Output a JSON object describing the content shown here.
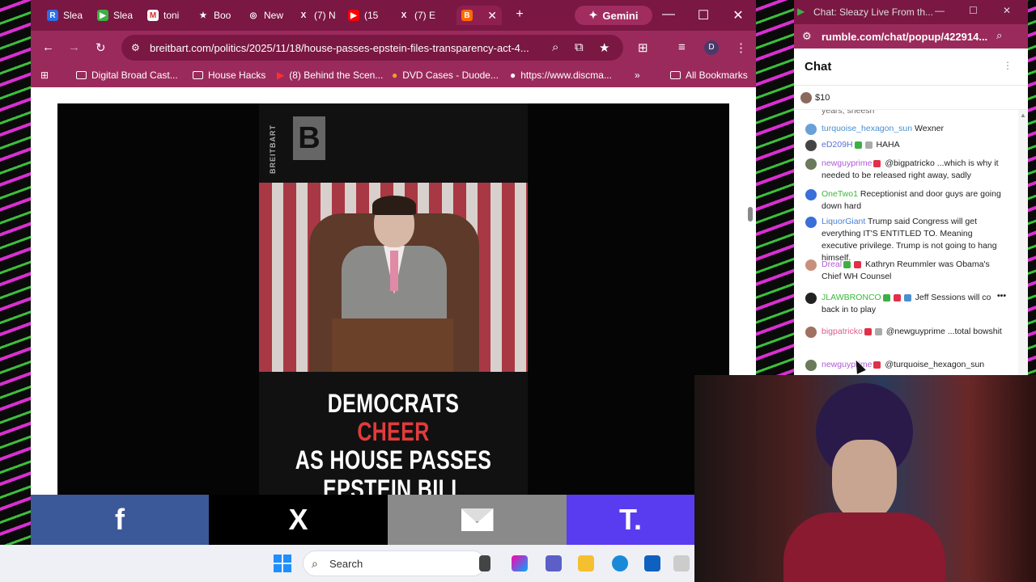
{
  "browser": {
    "tabs": [
      {
        "label": "Slea",
        "icon": "R",
        "color": "#2a6ee8"
      },
      {
        "label": "Slea",
        "icon": "▶",
        "color": "#3cb043"
      },
      {
        "label": "toni",
        "icon": "M",
        "color": "#d93025"
      },
      {
        "label": "Boo",
        "icon": "★",
        "color": "#555555"
      },
      {
        "label": "New",
        "icon": "◎",
        "color": "#555555"
      },
      {
        "label": "(7) N",
        "icon": "X",
        "color": "#000000"
      },
      {
        "label": "(15",
        "icon": "▶",
        "color": "#ff0000"
      },
      {
        "label": "(7) E",
        "icon": "X",
        "color": "#000000"
      }
    ],
    "active_tab_icon": "B",
    "gemini_label": "Gemini",
    "url": "breitbart.com/politics/2025/11/18/house-passes-epstein-files-transparency-act-4...",
    "profile_initial": "D",
    "bookmarks": [
      "Digital Broad Cast...",
      "House Hacks",
      "(8) Behind the Scen...",
      "DVD Cases - Duode...",
      "https://www.discma..."
    ],
    "all_bookmarks": "All Bookmarks"
  },
  "video": {
    "logo_letter": "B",
    "logo_word": "BREITBART",
    "headline_line1_a": "DEMOCRATS",
    "headline_line1_b": "CHEER",
    "headline_line2": "AS HOUSE PASSES",
    "headline_line3": "EPSTEIN BILL"
  },
  "share": {
    "facebook": "f",
    "x": "X",
    "truth": "T."
  },
  "taskbar": {
    "search_placeholder": "Search"
  },
  "chat": {
    "window_title": "Chat: Sleazy Live From th...",
    "url": "rumble.com/chat/popup/422914...",
    "heading": "Chat",
    "rant_amount": "$10",
    "cutoff_text": "years, sheesh",
    "messages": [
      {
        "user": "turquoise_hexagon_sun",
        "user_color": "#4a8fd0",
        "avatar": "#6aa0d8",
        "text": "Wexner"
      },
      {
        "user": "eD209H",
        "user_color": "#5a6fd6",
        "avatar": "#444444",
        "text": "HAHA"
      },
      {
        "user": "newguyprime",
        "user_color": "#b05ad8",
        "avatar": "#6b7a5a",
        "text": "@bigpatricko ...which is why it needed to be released right away, sadly"
      },
      {
        "user": "OneTwo1",
        "user_color": "#3ab83a",
        "avatar": "#3a6fd8",
        "text": "Receptionist and door guys are going down hard"
      },
      {
        "user": "LiquorGiant",
        "user_color": "#4a7fd8",
        "avatar": "#3a6fd8",
        "text": "Trump said Congress will get everything IT'S ENTITLED TO. Meaning executive privilege. Trump is not going to hang himself."
      },
      {
        "user": "Dreal",
        "user_color": "#b05ad8",
        "avatar": "#c8907a",
        "text": "Kathryn Reummler was Obama's Chief WH Counsel"
      },
      {
        "user": "JLAWBRONCO",
        "user_color": "#3ab83a",
        "avatar": "#222222",
        "text": "Jeff Sessions will co back in to play"
      },
      {
        "user": "bigpatricko",
        "user_color": "#e05a8a",
        "avatar": "#a07060",
        "text": "@newguyprime ...total bowshit"
      },
      {
        "user": "newguyprime",
        "user_color": "#b05ad8",
        "avatar": "#6b7a5a",
        "text": "@turquoise_hexagon_sun"
      }
    ]
  }
}
